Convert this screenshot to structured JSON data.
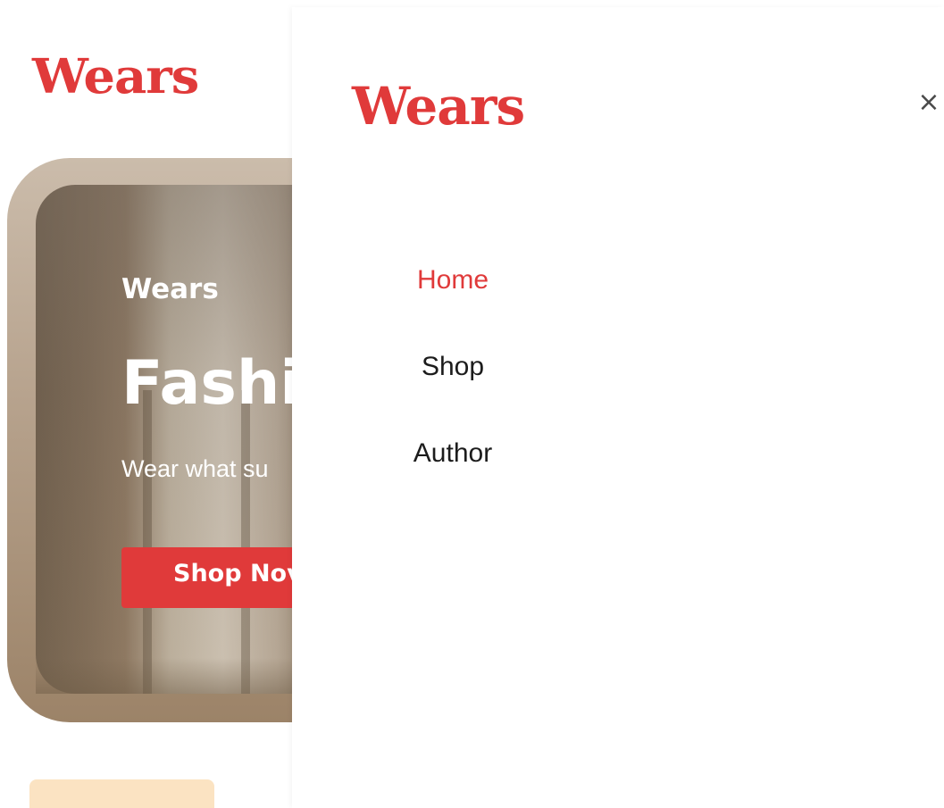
{
  "brand": {
    "logo_text": "Wears",
    "accent_color": "#e03a3a"
  },
  "background_page": {
    "hero": {
      "kicker": "Wears",
      "title": "Fashi",
      "subtitle": "Wear what su",
      "cta_label": "Shop Nov"
    }
  },
  "drawer": {
    "close_icon": "×",
    "nav_items": [
      {
        "label": "Home",
        "active": true
      },
      {
        "label": "Shop",
        "active": false
      },
      {
        "label": "Author",
        "active": false
      }
    ]
  }
}
